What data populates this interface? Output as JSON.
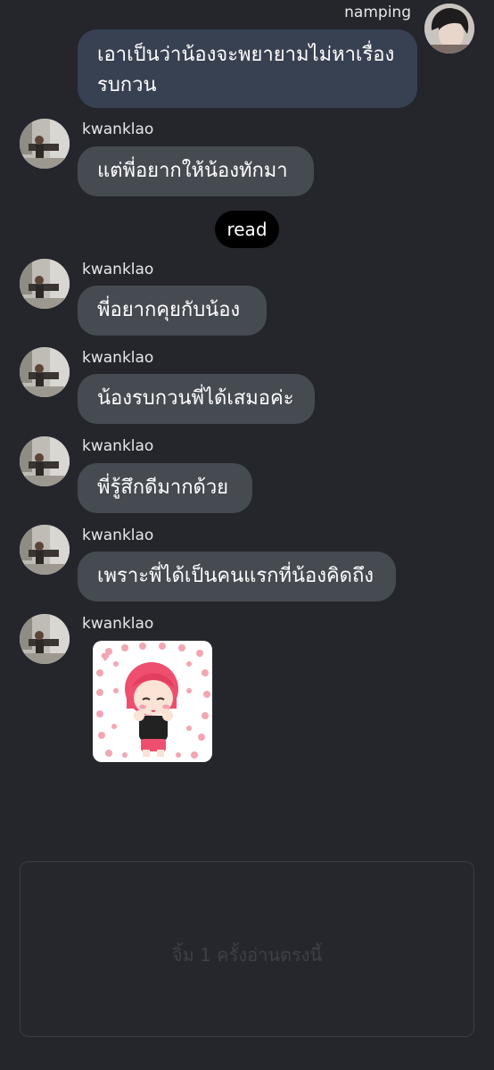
{
  "self": {
    "name": "namping"
  },
  "contact": {
    "name": "kwanklao"
  },
  "messages": [
    {
      "sender": "namping",
      "text": "เอาเป็นว่าน้องจะพยายามไม่หาเรื่องรบกวน"
    },
    {
      "sender": "kwanklao",
      "text": "แต่พี่อยากให้น้องทักมา"
    },
    {
      "sender": "kwanklao",
      "text": "พี่อยากคุยกับน้อง"
    },
    {
      "sender": "kwanklao",
      "text": "น้องรบกวนพี่ได้เสมอค่ะ"
    },
    {
      "sender": "kwanklao",
      "text": "พี่รู้สึกดีมากด้วย"
    },
    {
      "sender": "kwanklao",
      "text": "เพราะพี่ได้เป็นคนแรกที่น้องคิดถึง"
    },
    {
      "sender": "kwanklao",
      "sticker": "girl-hearts-sticker"
    }
  ],
  "read_label": "read",
  "input": {
    "placeholder": "จิ้ม 1 ครั้งอ่านตรงนี้"
  },
  "colors": {
    "background": "#24262c",
    "my_bubble": "#384152",
    "their_bubble": "#464a51",
    "read_pill": "#000000"
  }
}
